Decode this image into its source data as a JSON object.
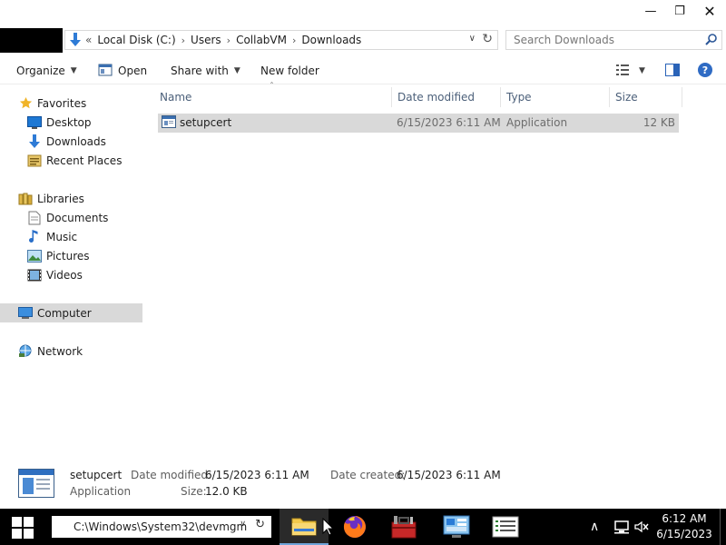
{
  "window": {
    "controls": {
      "minimize": "—",
      "maximize": "❐",
      "close": "✕"
    }
  },
  "address": {
    "overflow": "«",
    "crumbs": [
      "Local Disk (C:)",
      "Users",
      "CollabVM",
      "Downloads"
    ],
    "separator": "›"
  },
  "search": {
    "placeholder": "Search Downloads"
  },
  "toolbar": {
    "organize": "Organize",
    "open": "Open",
    "share_with": "Share with",
    "new_folder": "New folder"
  },
  "nav": {
    "favorites": "Favorites",
    "desktop": "Desktop",
    "downloads": "Downloads",
    "recent_places": "Recent Places",
    "libraries": "Libraries",
    "documents": "Documents",
    "music": "Music",
    "pictures": "Pictures",
    "videos": "Videos",
    "computer": "Computer",
    "network": "Network"
  },
  "columns": {
    "name": "Name",
    "date_modified": "Date modified",
    "type": "Type",
    "size": "Size"
  },
  "files": [
    {
      "name": "setupcert",
      "date_modified": "6/15/2023 6:11 AM",
      "type": "Application",
      "size": "12 KB"
    }
  ],
  "details": {
    "name": "setupcert",
    "type": "Application",
    "date_modified_label": "Date modified:",
    "date_modified": "6/15/2023 6:11 AM",
    "date_created_label": "Date created:",
    "date_created": "6/15/2023 6:11 AM",
    "size_label": "Size:",
    "size": "12.0 KB"
  },
  "taskbar": {
    "run_text": "C:\\Windows\\System32\\devmgm",
    "time": "6:12 AM",
    "date": "6/15/2023"
  },
  "colors": {
    "selection": "#d9d9d9",
    "header_text": "#4c607a",
    "taskbar": "#000000"
  }
}
